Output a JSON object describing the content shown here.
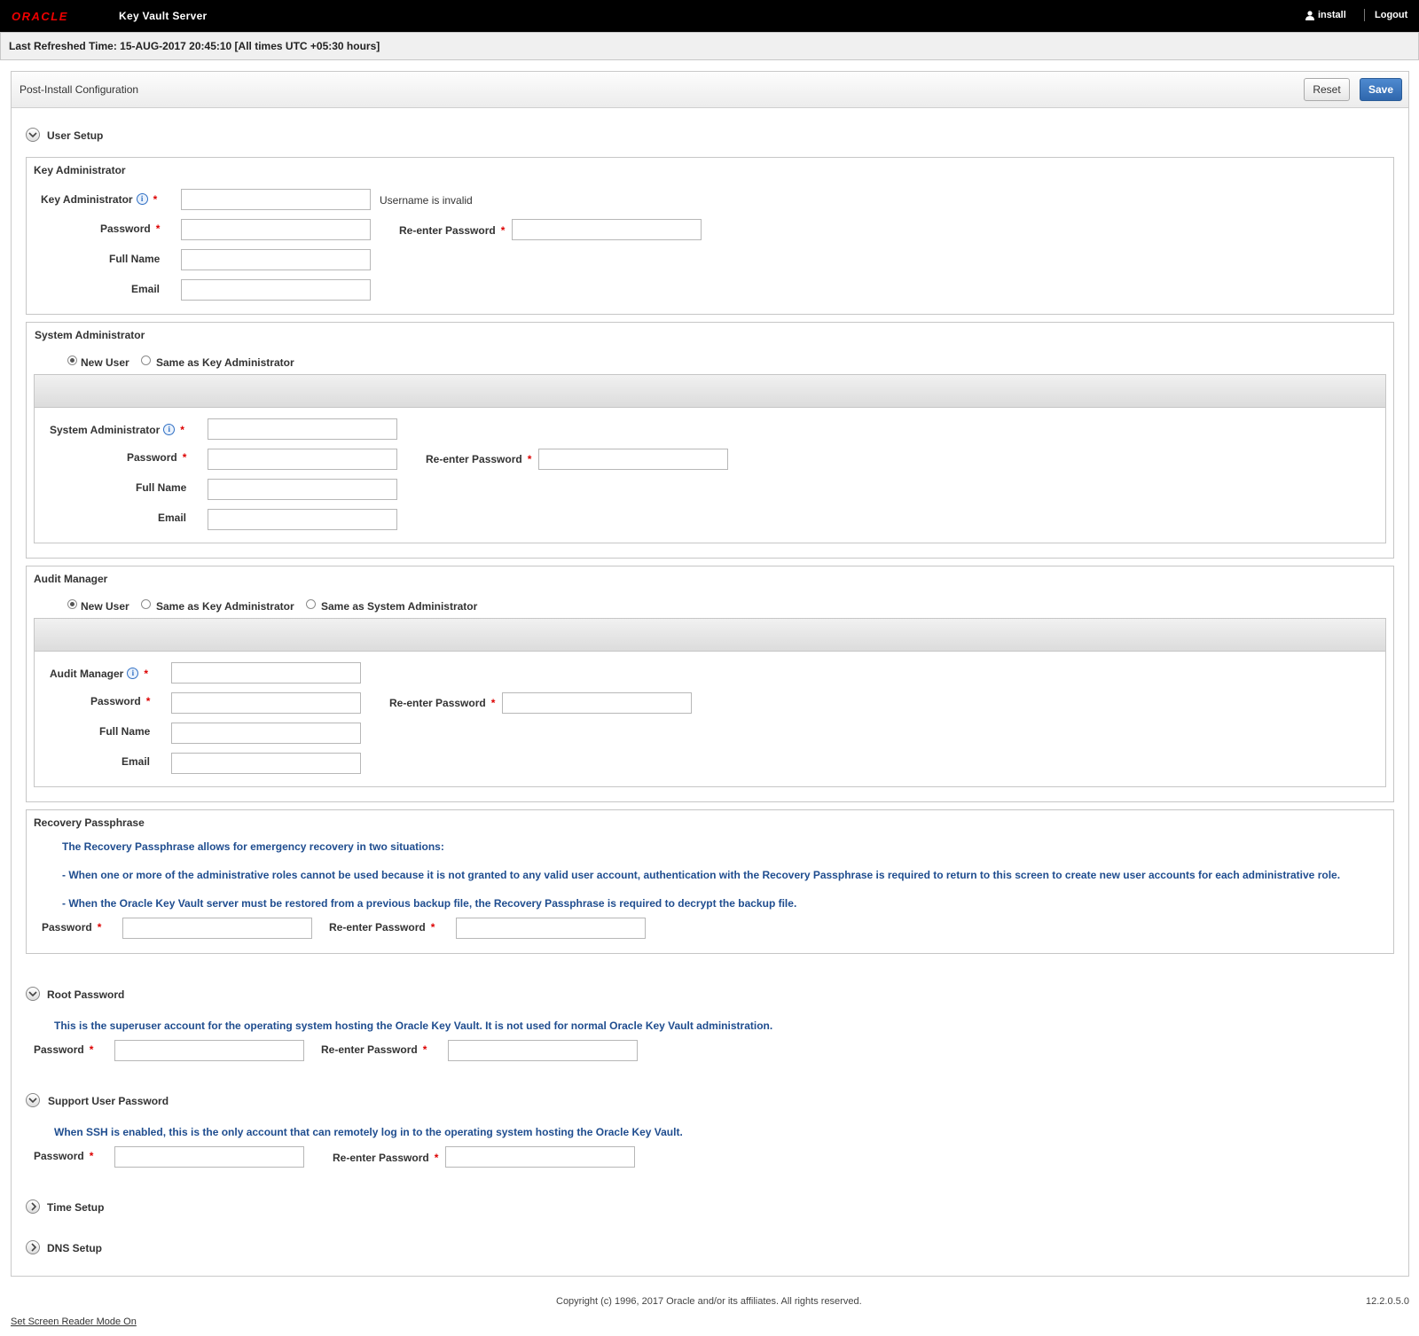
{
  "header": {
    "logo": "ORACLE",
    "app_title": "Key Vault Server",
    "user": "install",
    "logout": "Logout"
  },
  "refresh_text": "Last Refreshed Time: 15-AUG-2017 20:45:10 [All times UTC +05:30 hours]",
  "panel": {
    "title": "Post-Install Configuration",
    "reset": "Reset",
    "save": "Save"
  },
  "user_setup": {
    "heading": "User Setup",
    "key_admin": {
      "box_title": "Key Administrator",
      "user_label": "Key Administrator",
      "error": "Username is invalid",
      "password": "Password",
      "reenter": "Re-enter Password",
      "full_name": "Full Name",
      "email": "Email"
    },
    "sys_admin": {
      "box_title": "System Administrator",
      "radio_new": "New User",
      "radio_same_key": "Same as Key Administrator",
      "user_label": "System Administrator",
      "password": "Password",
      "reenter": "Re-enter Password",
      "full_name": "Full Name",
      "email": "Email"
    },
    "audit": {
      "box_title": "Audit Manager",
      "radio_new": "New User",
      "radio_same_key": "Same as Key Administrator",
      "radio_same_sys": "Same as System Administrator",
      "user_label": "Audit Manager",
      "password": "Password",
      "reenter": "Re-enter Password",
      "full_name": "Full Name",
      "email": "Email"
    },
    "recovery": {
      "box_title": "Recovery Passphrase",
      "note1": "The Recovery Passphrase allows for emergency recovery in two situations:",
      "note2": "- When one or more of the administrative roles cannot be used because it is not granted to any valid user account, authentication with the Recovery Passphrase is required to return to this screen to create new user accounts for each administrative role.",
      "note3": "- When the Oracle Key Vault server must be restored from a previous backup file, the Recovery Passphrase is required to decrypt the backup file.",
      "password": "Password",
      "reenter": "Re-enter Password"
    }
  },
  "root": {
    "heading": "Root Password",
    "note": "This is the superuser account for the operating system hosting the Oracle Key Vault. It is not used for normal Oracle Key Vault administration.",
    "password": "Password",
    "reenter": "Re-enter Password"
  },
  "support": {
    "heading": "Support User Password",
    "note": "When SSH is enabled, this is the only account that can remotely log in to the operating system hosting the Oracle Key Vault.",
    "password": "Password",
    "reenter": "Re-enter Password"
  },
  "time_setup": "Time Setup",
  "dns_setup": "DNS Setup",
  "footer": {
    "copyright": "Copyright (c) 1996, 2017 Oracle and/or its affiliates. All rights reserved.",
    "version": "12.2.0.5.0",
    "screen_reader": "Set Screen Reader Mode On"
  }
}
